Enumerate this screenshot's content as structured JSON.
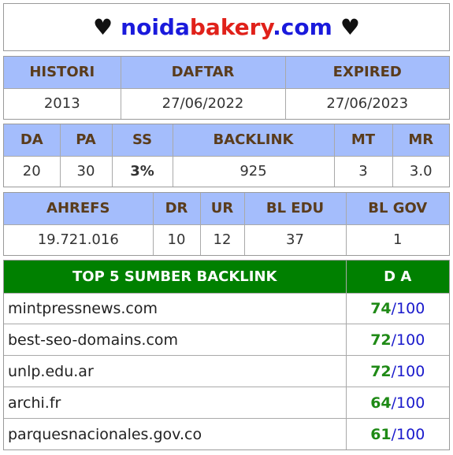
{
  "title": {
    "heart_left": "♥",
    "part1": "noida",
    "part2": "bakery",
    "part3": ".com",
    "heart_right": "♥"
  },
  "history_table": {
    "headers": [
      "HISTORI",
      "DAFTAR",
      "EXPIRED"
    ],
    "values": [
      "2013",
      "27/06/2022",
      "27/06/2023"
    ]
  },
  "metrics_table": {
    "headers": [
      "DA",
      "PA",
      "SS",
      "BACKLINK",
      "MT",
      "MR"
    ],
    "values": [
      "20",
      "30",
      "3%",
      "925",
      "3",
      "3.0"
    ]
  },
  "ahrefs_table": {
    "headers": [
      "AHREFS",
      "DR",
      "UR",
      "BL EDU",
      "BL GOV"
    ],
    "values": [
      "19.721.016",
      "10",
      "12",
      "37",
      "1"
    ]
  },
  "top_backlinks": {
    "header_source": "TOP 5 SUMBER BACKLINK",
    "header_da": "D A",
    "max": "/100",
    "rows": [
      {
        "domain": "mintpressnews.com",
        "da": "74"
      },
      {
        "domain": "best-seo-domains.com",
        "da": "72"
      },
      {
        "domain": "unlp.edu.ar",
        "da": "72"
      },
      {
        "domain": "archi.fr",
        "da": "64"
      },
      {
        "domain": "parquesnacionales.gov.co",
        "da": "61"
      }
    ]
  },
  "colors": {
    "header_bg": "#a4bdfc",
    "header_text": "#5a3c1c",
    "top_header_bg": "#008000",
    "green_value": "#1f8a16",
    "blue_value": "#1a1acc",
    "brand_blue": "#1a1adc",
    "brand_red": "#e0211a"
  }
}
